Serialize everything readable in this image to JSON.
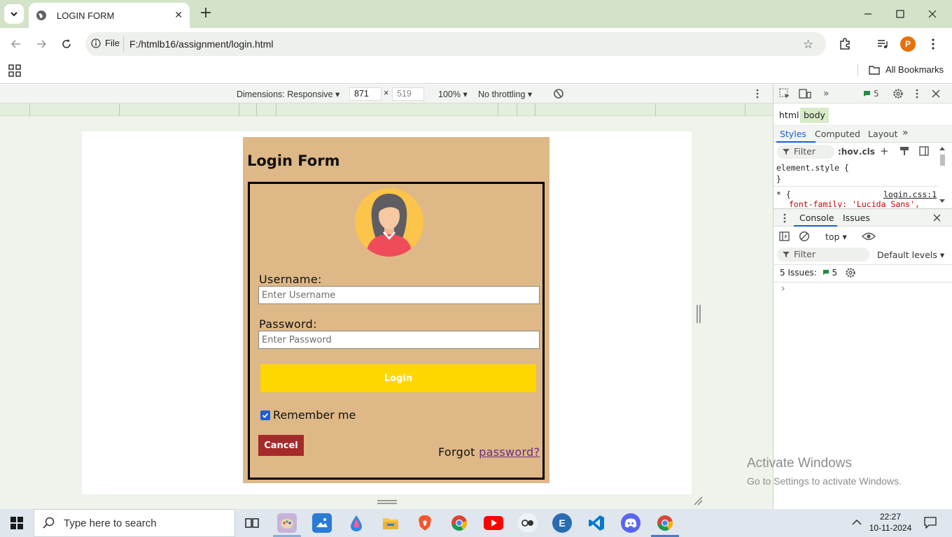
{
  "browser": {
    "tab_title": "LOGIN FORM",
    "address_scheme": "File",
    "address_url": "F:/htmlb16/assignment/login.html",
    "profile_initial": "P",
    "bookmarks_label": "All Bookmarks"
  },
  "device_toolbar": {
    "dimensions_label": "Dimensions: Responsive",
    "width": "871",
    "height": "519",
    "zoom": "100%",
    "throttling": "No throttling"
  },
  "page": {
    "title": "Login Form",
    "username_label": "Username:",
    "username_placeholder": "Enter Username",
    "password_label": "Password:",
    "password_placeholder": "Enter Password",
    "login_button": "Login",
    "remember_label": "Remember me",
    "remember_checked": true,
    "cancel_button": "Cancel",
    "forgot_prefix": "Forgot",
    "forgot_link": "password?",
    "colors": {
      "background": "#deb887",
      "login": "#ffd700",
      "cancel": "#a52a2a",
      "link": "#6a2b8a"
    }
  },
  "devtools": {
    "issues_badge": "5",
    "crumbs": [
      "html",
      "body"
    ],
    "style_tabs": [
      "Styles",
      "Computed",
      "Layout"
    ],
    "filter_placeholder": "Filter",
    "hov": ":hov",
    "cls": ".cls",
    "element_style": "element.style {",
    "closing_brace": "}",
    "star_rule": "* {",
    "rule_source": "login.css:1",
    "font_decl": "font-family: 'Lucida Sans',",
    "drawer_tabs": [
      "Console",
      "Issues"
    ],
    "context": "top",
    "console_filter": "Filter",
    "levels": "Default levels",
    "issues_summary": "5 Issues:",
    "issues_count": "5",
    "prompt": "›"
  },
  "watermark": {
    "line1": "Activate Windows",
    "line2": "Go to Settings to activate Windows."
  },
  "taskbar": {
    "search_placeholder": "Type here to search",
    "time": "22:27",
    "date": "10-11-2024"
  }
}
